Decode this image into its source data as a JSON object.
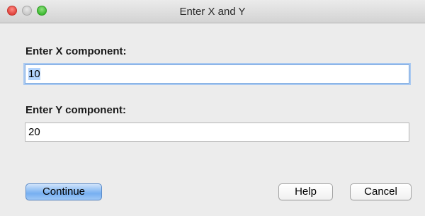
{
  "window": {
    "title": "Enter X and Y"
  },
  "form": {
    "x_label": "Enter X component:",
    "x_value": "10",
    "y_label": "Enter Y component:",
    "y_value": "20"
  },
  "buttons": {
    "continue_label": "Continue",
    "help_label": "Help",
    "cancel_label": "Cancel"
  },
  "colors": {
    "primary_button": "#76aff1",
    "focus_ring": "#a9c9f1",
    "selection": "#b3d4fd"
  }
}
